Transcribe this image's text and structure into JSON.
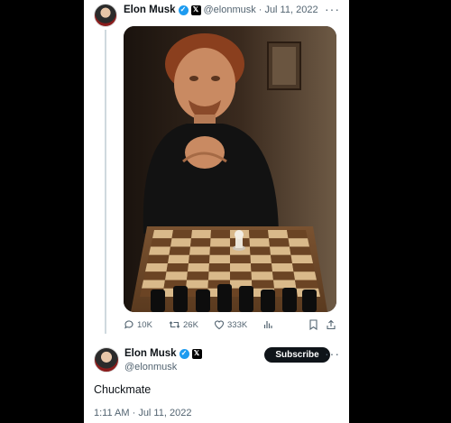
{
  "tweet": {
    "author": {
      "name": "Elon Musk",
      "handle": "@elonmusk"
    },
    "date": "Jul 11, 2022",
    "date_sep": "·",
    "more_glyph": "···",
    "stats": {
      "replies": "10K",
      "retweets": "26K",
      "likes": "333K"
    }
  },
  "quote_tweet": {
    "author": {
      "name": "Elon Musk",
      "handle": "@elonmusk"
    },
    "subscribe_label": "Subscribe",
    "more_glyph": "···",
    "text": "Chuckmate",
    "timestamp": "1:11 AM · Jul 11, 2022"
  },
  "colors": {
    "accent_blue": "#1d9bf0",
    "text_primary": "#0f1419",
    "text_secondary": "#536471"
  },
  "icons": [
    "verified-badge-icon",
    "x-logo-icon",
    "reply-icon",
    "retweet-icon",
    "like-icon",
    "views-icon",
    "bookmark-icon",
    "share-icon",
    "more-icon"
  ]
}
